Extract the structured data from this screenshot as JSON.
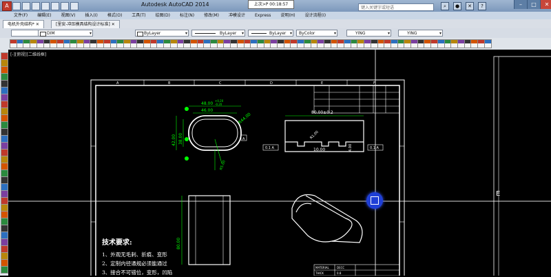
{
  "window": {
    "title": "Autodesk AutoCAD 2014",
    "timer": "上次>P 00:18:57",
    "search_placeholder": "键入关键字或短语"
  },
  "menu": [
    "文件(F)",
    "编辑(E)",
    "视图(V)",
    "插入(I)",
    "格式(O)",
    "工具(T)",
    "绘图(D)",
    "标注(N)",
    "修改(M)",
    "冲模设计",
    "Express",
    "说明(H)",
    "设计流程(I)"
  ],
  "tabs": [
    {
      "label": "电机外壳结构*",
      "active": true
    },
    {
      "label": "[里安-冲压模具结构设计标准]",
      "active": false
    }
  ],
  "properties": {
    "layer": "DIM",
    "color": "ByLayer",
    "linetype": "ByLayer",
    "lineweight": "ByLayer",
    "plotstyle": "ByColor",
    "textstyle": "YING",
    "dimstyle": "YING"
  },
  "viewport_label": "[-][俯视][二维线框]",
  "border_letters": [
    "A",
    "B",
    "C",
    "D",
    "E",
    "F"
  ],
  "right_letter": "E",
  "dims": {
    "width_top": "48.00",
    "width_tol_up": "+0.20",
    "width_tol_dn": "-0.20",
    "width_inner": "46.00",
    "height_left": "42.00",
    "height_left2": "38.00",
    "radius_big": "R44.00",
    "radius_small": "R5.00",
    "slot_len": "80.00±0.2",
    "slot_r": "R1.00",
    "slot_w": "10.00",
    "slot_h": "4.00",
    "tol_frame": "0.1 A",
    "side_h": "80.00",
    "datum": "A"
  },
  "requirements": {
    "title": "技术要求:",
    "items": [
      "1、外观无毛刺、折痕、变形",
      "2、定制内径通规必须能通过",
      "3、接合不可错位，变形，凹陷"
    ]
  },
  "title_block": {
    "r1": "MATERIAL",
    "r1v": "DECC",
    "r2": "THICK",
    "r2v": "0.8"
  }
}
